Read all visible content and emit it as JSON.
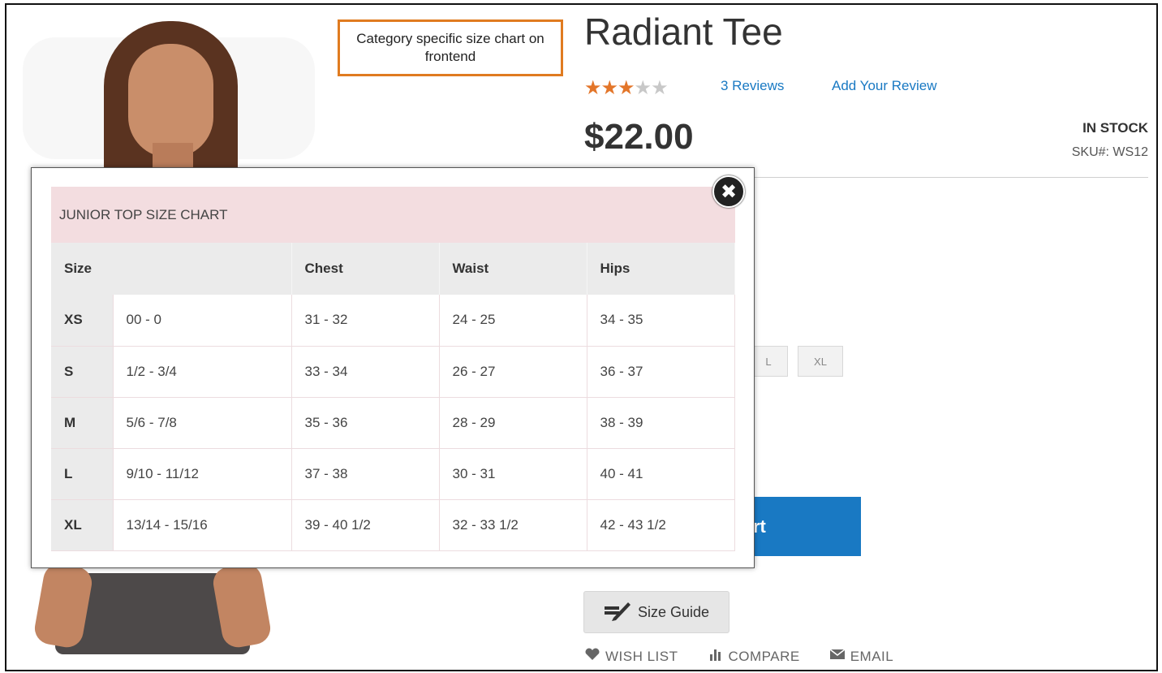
{
  "annotation": "Category specific size chart on frontend",
  "product": {
    "title": "Radiant Tee",
    "rating": {
      "filled": 3,
      "total": 5
    },
    "reviews_link": "3 Reviews",
    "add_review_link": "Add Your Review",
    "price": "$22.00",
    "stock": "IN STOCK",
    "sku": "SKU#:  WS12",
    "size_options_visible": [
      "L",
      "XL"
    ],
    "add_to_cart_partial": "rt",
    "size_guide_label": "Size Guide",
    "actions": [
      "WISH LIST",
      "COMPARE",
      "EMAIL"
    ]
  },
  "size_chart": {
    "title": "JUNIOR TOP SIZE CHART",
    "headers": [
      "Size",
      "Chest",
      "Waist",
      "Hips"
    ],
    "rows": [
      {
        "size": "XS",
        "range": "00 - 0",
        "chest": "31 - 32",
        "waist": "24 - 25",
        "hips": "34 - 35"
      },
      {
        "size": "S",
        "range": "1/2 - 3/4",
        "chest": "33 - 34",
        "waist": "26 - 27",
        "hips": "36 - 37"
      },
      {
        "size": "M",
        "range": "5/6 - 7/8",
        "chest": "35 - 36",
        "waist": "28 - 29",
        "hips": "38 - 39"
      },
      {
        "size": "L",
        "range": "9/10 - 11/12",
        "chest": "37 - 38",
        "waist": "30 - 31",
        "hips": "40 - 41"
      },
      {
        "size": "XL",
        "range": "13/14 - 15/16",
        "chest": "39 - 40 1/2",
        "waist": "32 - 33 1/2",
        "hips": "42 - 43 1/2"
      }
    ],
    "close_glyph": "✖"
  },
  "colors": {
    "accent_orange": "#e07b20",
    "link_blue": "#1979c3",
    "star": "#e3762a",
    "chart_header_pink": "#f3dde0"
  }
}
